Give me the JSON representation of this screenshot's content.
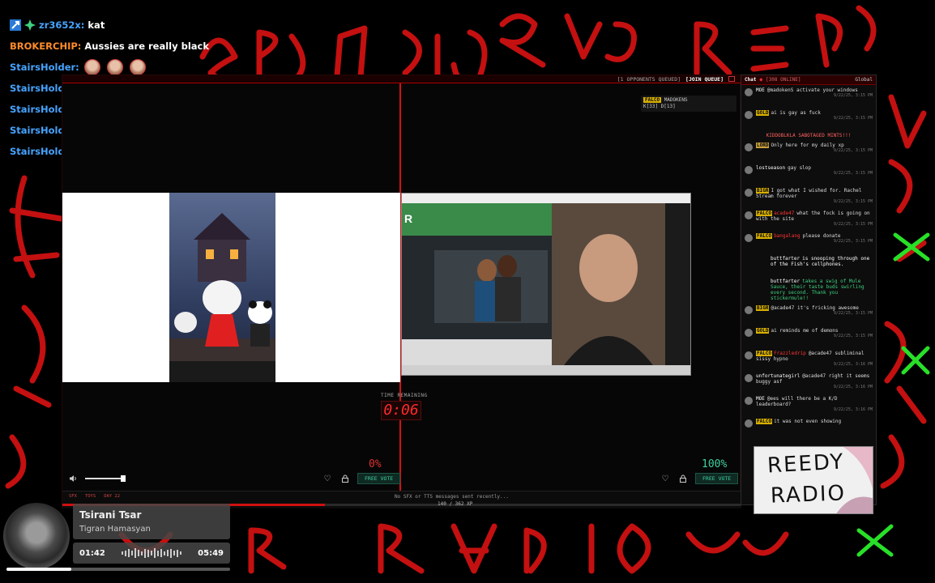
{
  "overlay_chat": [
    {
      "name": "zr3652x",
      "message": "kat",
      "color": "blue"
    },
    {
      "name": "BROKERCHIP",
      "message": "Aussies are really black",
      "color": "orange"
    },
    {
      "name": "StairsHolder",
      "message": "",
      "color": "blue"
    },
    {
      "name": "StairsHolder",
      "message": "",
      "color": "blue"
    },
    {
      "name": "StairsHolder",
      "message": "",
      "color": "blue"
    },
    {
      "name": "StairsHolder",
      "message": "",
      "color": "blue"
    },
    {
      "name": "StairsHolder",
      "message": "",
      "color": "blue"
    }
  ],
  "app": {
    "queue_text": "[1 OPPONENTS QUEUED]",
    "join_queue": "[JOIN QUEUE]",
    "matchup_badge": "FALCO",
    "matchup_name": "MADOKENS",
    "matchup_stats": "K[33] D[13]",
    "time_remaining_label": "TIME REMAINING",
    "timer": "0:06",
    "left_percent": "0%",
    "right_percent": "100%",
    "free_vote_label": "FREE VOTE",
    "sfx_tags": [
      "SFX",
      "TOYS",
      "DAY 22"
    ],
    "sfx_status": "No SFX or TTS messages sent recently...",
    "xp_label": "140 / 362 XP",
    "xp_progress": 0.387,
    "volume_level": 1.0
  },
  "chat": {
    "title": "Chat",
    "online": "[308 ONLINE]",
    "scope": "Global",
    "messages": [
      {
        "badge": "",
        "user": "MOE",
        "text": "@madokenS activate your windows",
        "time": "9/22/25, 3:15 PM",
        "type": "msg"
      },
      {
        "badge": "GOLD",
        "user": "",
        "text": "ai is gay as fuck",
        "time": "9/22/25, 3:15 PM",
        "type": "msg"
      },
      {
        "badge": "",
        "user": "",
        "text": "KIDDOBLKLA SABOTAGED MINTS!!!",
        "time": "",
        "type": "system"
      },
      {
        "badge": "LORD",
        "user": "",
        "text": "Only here for my daily xp",
        "time": "9/22/25, 3:15 PM",
        "type": "msg"
      },
      {
        "badge": "",
        "user": "lostseason",
        "text": "gay slop",
        "time": "9/22/25, 3:15 PM",
        "type": "msg"
      },
      {
        "badge": "BIGR",
        "user": "",
        "text": "I got what I wished for. Rachel Stream forever",
        "time": "9/22/25, 3:15 PM",
        "type": "msg"
      },
      {
        "badge": "FALCO",
        "user": "acade47",
        "text": "what the fock is going on with the site",
        "time": "9/22/25, 3:15 PM",
        "type": "msg"
      },
      {
        "badge": "FALCO",
        "user": "bangalang",
        "text": "please donate",
        "time": "9/22/25, 3:15 PM",
        "type": "msg"
      },
      {
        "badge": "",
        "user": "buttfarter",
        "text": "is snooping through one of the Fish's cellphones.",
        "time": "",
        "type": "notice"
      },
      {
        "badge": "",
        "user": "buttfarter",
        "text": "takes a swig of Mule Sauce, their taste buds swirling every second. Thank you stickermule!!",
        "time": "",
        "type": "notice-green"
      },
      {
        "badge": "BIGR",
        "user": "",
        "text": "@acade47 it's fricking awesome",
        "time": "9/22/25, 3:15 PM",
        "type": "msg"
      },
      {
        "badge": "GOLD",
        "user": "",
        "text": "ai reminds me of demons",
        "time": "9/22/25, 3:15 PM",
        "type": "msg"
      },
      {
        "badge": "FALCO",
        "user": "Frazzledrip",
        "text": "@acade47 subliminal sissy hypno",
        "time": "9/22/25, 3:16 PM",
        "type": "msg"
      },
      {
        "badge": "",
        "user": "unfortunategirl",
        "text": "@acade47 right it seems buggy asf",
        "time": "9/22/25, 3:16 PM",
        "type": "msg"
      },
      {
        "badge": "",
        "user": "MOE",
        "text": "@ees will there be a K/D leaderboard?",
        "time": "9/22/25, 3:16 PM",
        "type": "msg"
      },
      {
        "badge": "FALCO",
        "user": "",
        "text": "it was not even showing",
        "time": "",
        "type": "msg"
      }
    ]
  },
  "logo": {
    "line1": "REEDY",
    "line2": "RADIO"
  },
  "now_playing": {
    "title": "Tsirani Tsar",
    "artist": "Tigran Hamasyan",
    "elapsed": "01:42",
    "duration": "05:49",
    "progress": 0.29
  },
  "colors": {
    "accent_red": "#d01010",
    "vote_green": "#3fd0a0",
    "chat_username_blue": "#46a3ff",
    "badge_gold": "#d8b000"
  }
}
